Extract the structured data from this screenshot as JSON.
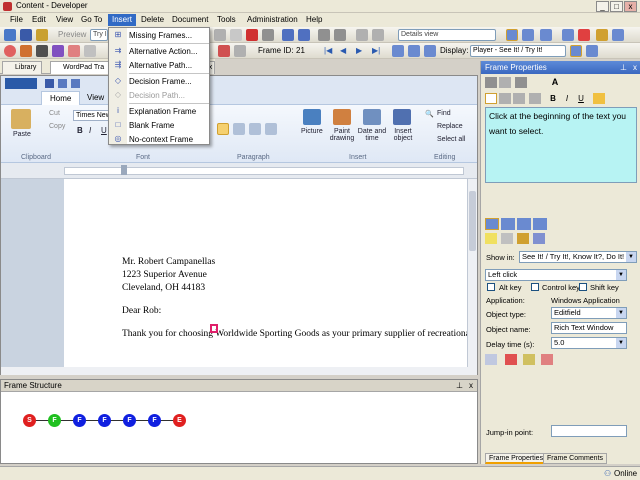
{
  "window": {
    "title": "Content - Developer"
  },
  "menubar": {
    "items": [
      "File",
      "Edit",
      "View",
      "Go To",
      "Insert",
      "Delete",
      "Document",
      "Tools",
      "Administration",
      "Help"
    ],
    "active": "Insert"
  },
  "insert_menu": {
    "items": [
      {
        "label": "Missing Frames...",
        "disabled": false,
        "icon": "missing-frames-icon"
      },
      {
        "label": "Alternative Action...",
        "disabled": false,
        "icon": "alt-action-icon"
      },
      {
        "label": "Alternative Path...",
        "disabled": false,
        "icon": "alt-path-icon"
      },
      {
        "label": "Decision Frame...",
        "disabled": false,
        "icon": "decision-frame-icon"
      },
      {
        "label": "Decision Path...",
        "disabled": true,
        "icon": "decision-path-icon"
      },
      {
        "label": "Explanation Frame",
        "disabled": false,
        "icon": "explanation-frame-icon"
      },
      {
        "label": "Blank Frame",
        "disabled": false,
        "icon": "blank-frame-icon"
      },
      {
        "label": "No-context Frame",
        "disabled": false,
        "icon": "no-context-frame-icon"
      }
    ]
  },
  "toolbar": {
    "preview_label": "Preview",
    "try_combo": "Try I",
    "view_combo": "Details view",
    "frame_id_label": "Frame ID:",
    "frame_id_value": "21",
    "display_label": "Display:",
    "display_value": "Player - See It! / Try It!"
  },
  "doc_tabs": [
    "Library",
    "WordPad Tra"
  ],
  "wordpad": {
    "tabs": [
      "Home",
      "View"
    ],
    "font_name": "Times New",
    "clipboard": {
      "paste": "Paste",
      "cut": "Cut",
      "copy": "Copy",
      "label": "Clipboard"
    },
    "groups": [
      "Clipboard",
      "Font",
      "Paragraph",
      "Insert",
      "Editing"
    ],
    "insert_items": [
      "Picture",
      "Paint drawing",
      "Date and time",
      "Insert object"
    ],
    "editing_items": [
      "Find",
      "Replace",
      "Select all"
    ],
    "letter": {
      "name": "Mr. Robert Campanellas",
      "street": "1223 Superior Avenue",
      "city": "Cleveland, OH  44183",
      "greeting": "Dear Rob:",
      "body": "Thank you for choosing Worldwide Sporting Goods as your primary supplier of recreationa"
    }
  },
  "frame_structure": {
    "title": "Frame Structure",
    "nodes": [
      {
        "label": "S",
        "color": "#e02020"
      },
      {
        "label": "F",
        "color": "#20c020"
      },
      {
        "label": "F",
        "color": "#1020e0"
      },
      {
        "label": "F",
        "color": "#1020e0"
      },
      {
        "label": "F",
        "color": "#1020e0"
      },
      {
        "label": "F",
        "color": "#1020e0"
      },
      {
        "label": "E",
        "color": "#e02020"
      }
    ]
  },
  "frame_properties": {
    "title": "Frame Properties",
    "instruction": "Click at the beginning of the text you want to select.",
    "show_in_label": "Show in:",
    "show_in_value": "See It! / Try It!, Know It?, Do It!",
    "action": "Left click",
    "alt_key": "Alt key",
    "control_key": "Control key",
    "shift_key": "Shift key",
    "application_label": "Application:",
    "application_value": "Windows Application",
    "object_type_label": "Object type:",
    "object_type_value": "Editfield",
    "object_name_label": "Object name:",
    "object_name_value": "Rich Text Window",
    "delay_label": "Delay time (s):",
    "delay_value": "5.0",
    "jump_in_label": "Jump-in point:",
    "tabs": [
      "Frame Properties",
      "Frame Comments"
    ]
  },
  "status": {
    "online": "Online"
  },
  "colors": {
    "accent": "#316ac5",
    "instruction_bg": "#b7f3f3"
  }
}
